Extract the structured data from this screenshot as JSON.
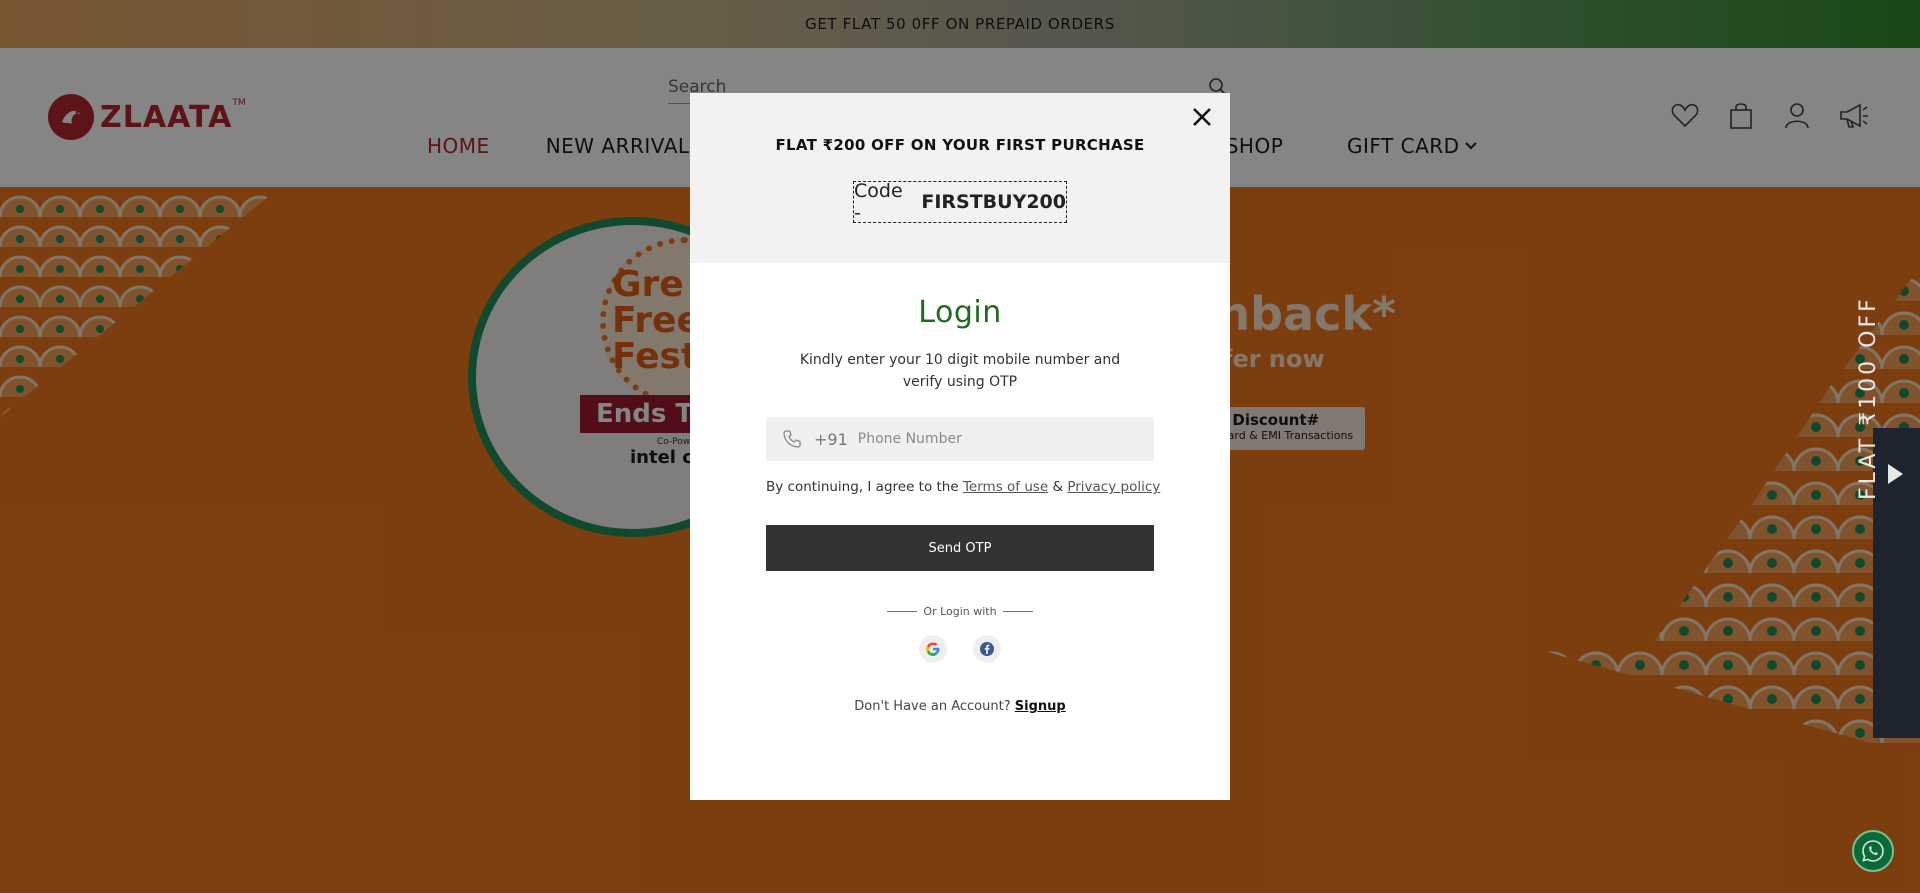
{
  "announcement": {
    "text": "GET FLAT 50 0FF ON PREPAID ORDERS"
  },
  "header": {
    "logo_text": "ZLAATA",
    "logo_tm": "TM",
    "search_placeholder": "Search",
    "nav": [
      {
        "label": "HOME",
        "active": true
      },
      {
        "label": "NEW ARRIVAL",
        "active": false
      }
    ],
    "nav_partial_shop": "-SHOP",
    "nav_gift_card": "GIFT CARD",
    "icons": [
      "heart-icon",
      "bag-icon",
      "user-icon",
      "megaphone-icon"
    ]
  },
  "hero": {
    "badge_text": "Gre\nFree\nFest",
    "ribbon": "Ends T",
    "copowered": "Co-Powe",
    "intel": "intel co",
    "cashback": "shback*",
    "offer_now": "fer now",
    "discount_line1": "t Discount#",
    "discount_line2": "Card & EMI Transactions"
  },
  "side_tab": {
    "text": "FLAT ₹100 OFF"
  },
  "modal": {
    "promo_title": "FLAT ₹200 OFF ON YOUR FIRST PURCHASE",
    "code_prefix": "Code -",
    "code_value": "FIRSTBUY200",
    "login_title": "Login",
    "login_subtitle": "Kindly enter your 10 digit mobile number and verify using OTP",
    "country_code": "+91",
    "phone_placeholder": "Phone Number",
    "agree_prefix": "By continuing, I agree to the",
    "terms_label": "Terms of use",
    "amp": "&",
    "privacy_label": "Privacy policy",
    "send_otp_label": "Send OTP",
    "or_login_label": "Or Login with",
    "no_account_label": "Don't Have an Account?",
    "signup_label": "Signup"
  },
  "colors": {
    "brand": "#b3262e",
    "login_title": "#1f6b1f",
    "button": "#333333",
    "hero_orange": "#f0781e"
  }
}
